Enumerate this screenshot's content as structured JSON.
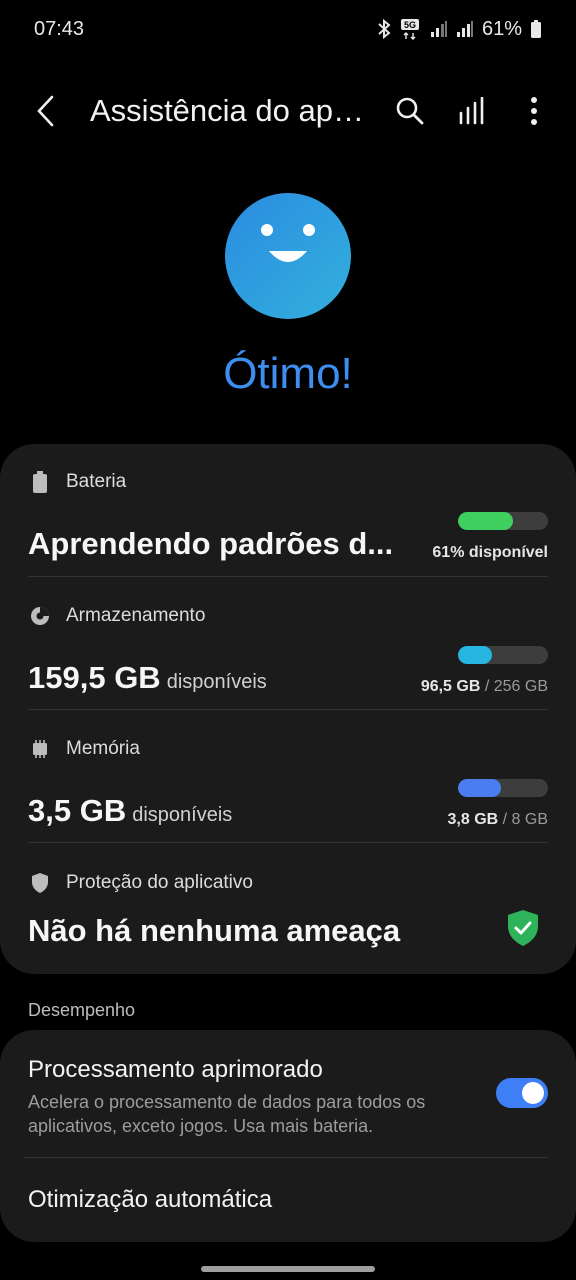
{
  "status": {
    "time": "07:43",
    "battery_percent": "61%"
  },
  "header": {
    "title": "Assistência do aparelho"
  },
  "hero": {
    "title": "Ótimo!"
  },
  "battery": {
    "label": "Bateria",
    "status": "Aprendendo padrões d...",
    "caption": "61% disponível",
    "level": 0.61,
    "color": "#3ecf5e"
  },
  "storage": {
    "label": "Armazenamento",
    "value": "159,5 GB",
    "unit_label": "disponíveis",
    "used": "96,5 GB",
    "total": " / 256 GB",
    "level": 0.377,
    "color": "#27b6e0"
  },
  "memory": {
    "label": "Memória",
    "value": "3,5 GB",
    "unit_label": "disponíveis",
    "used": "3,8 GB",
    "total": " / 8 GB",
    "level": 0.475,
    "color": "#4a7ef0"
  },
  "protection": {
    "label": "Proteção do aplicativo",
    "status": "Não há nenhuma ameaça"
  },
  "performance": {
    "section_label": "Desempenho",
    "enhanced_title": "Processamento aprimorado",
    "enhanced_desc": "Acelera o processamento de dados para todos os aplicativos, exceto jogos. Usa mais bateria.",
    "enhanced_on": true,
    "auto_opt_title": "Otimização automática"
  }
}
